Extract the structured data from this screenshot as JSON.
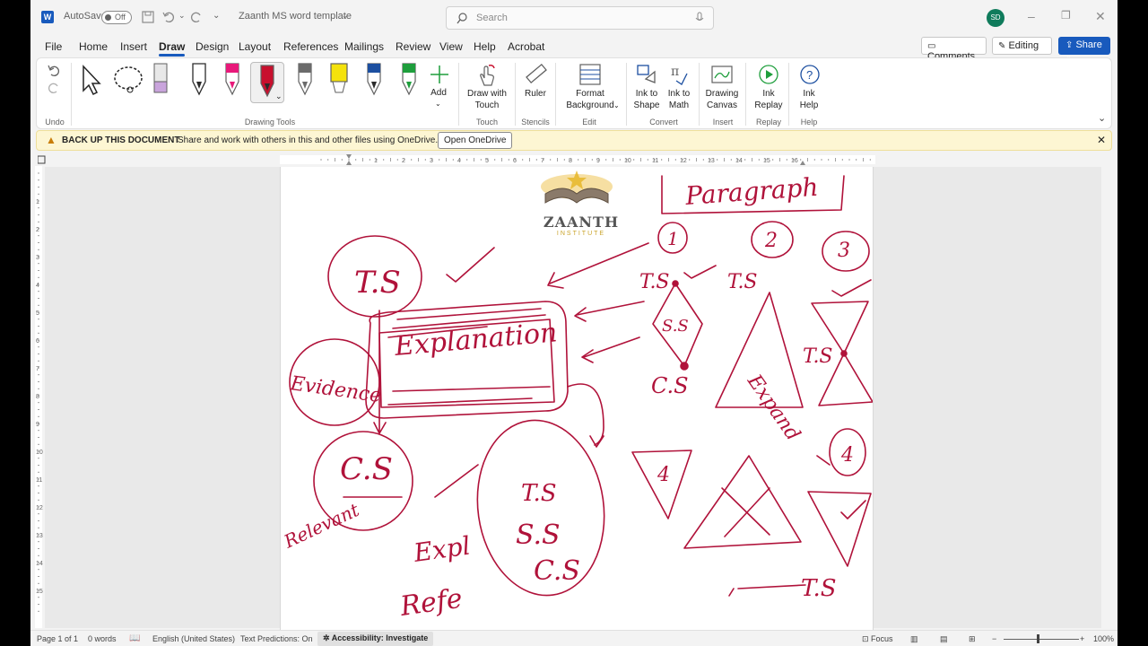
{
  "titlebar": {
    "autosave_label": "AutoSave",
    "autosave_state": "Off",
    "doc_title": "Zaanth MS word template",
    "search_placeholder": "Search",
    "avatar_initials": "SD"
  },
  "tabs": [
    "File",
    "Home",
    "Insert",
    "Draw",
    "Design",
    "Layout",
    "References",
    "Mailings",
    "Review",
    "View",
    "Help",
    "Acrobat"
  ],
  "active_tab": "Draw",
  "top_buttons": {
    "comments": "Comments",
    "editing": "Editing",
    "share": "Share"
  },
  "ribbon": {
    "groups": {
      "undo": "Undo",
      "drawing_tools": "Drawing Tools",
      "touch": "Touch",
      "stencils": "Stencils",
      "edit": "Edit",
      "convert": "Convert",
      "insert": "Insert",
      "replay": "Replay",
      "help": "Help"
    },
    "buttons": {
      "add": "Add",
      "draw_touch_1": "Draw with",
      "draw_touch_2": "Touch",
      "ruler": "Ruler",
      "format_bg_1": "Format",
      "format_bg_2": "Background",
      "ink_shape_1": "Ink to",
      "ink_shape_2": "Shape",
      "ink_math_1": "Ink to",
      "ink_math_2": "Math",
      "drawing_canvas_1": "Drawing",
      "drawing_canvas_2": "Canvas",
      "ink_replay_1": "Ink",
      "ink_replay_2": "Replay",
      "ink_help_1": "Ink",
      "ink_help_2": "Help"
    },
    "pen_colors": [
      "#2b2b2b",
      "#e8197a",
      "#c8102e",
      "#6b6b6b",
      "#f4e20c",
      "#1c4fa0",
      "#1e9e3c"
    ]
  },
  "infobar": {
    "title": "BACK UP THIS DOCUMENT",
    "message": "Share and work with others in this and other files using OneDrive.",
    "button": "Open OneDrive"
  },
  "document": {
    "logo_name": "ZAANTH",
    "logo_sub": "INSTITUTE",
    "ink_color": "#b0123a",
    "ink_labels": {
      "paragraph": "Paragraph",
      "ts": "T.S",
      "cs": "C.S",
      "ss": "S.S",
      "explanation": "Explanation",
      "evidence": "Evidence",
      "relevant": "Relevant",
      "expl": "Expl",
      "refe": "Refe",
      "expand": "Expand",
      "n1": "1",
      "n2": "2",
      "n3": "3",
      "n4": "4"
    }
  },
  "statusbar": {
    "page": "Page 1 of 1",
    "words": "0 words",
    "language": "English (United States)",
    "predictions": "Text Predictions: On",
    "accessibility": "Accessibility: Investigate",
    "focus": "Focus",
    "zoom": "100%"
  }
}
